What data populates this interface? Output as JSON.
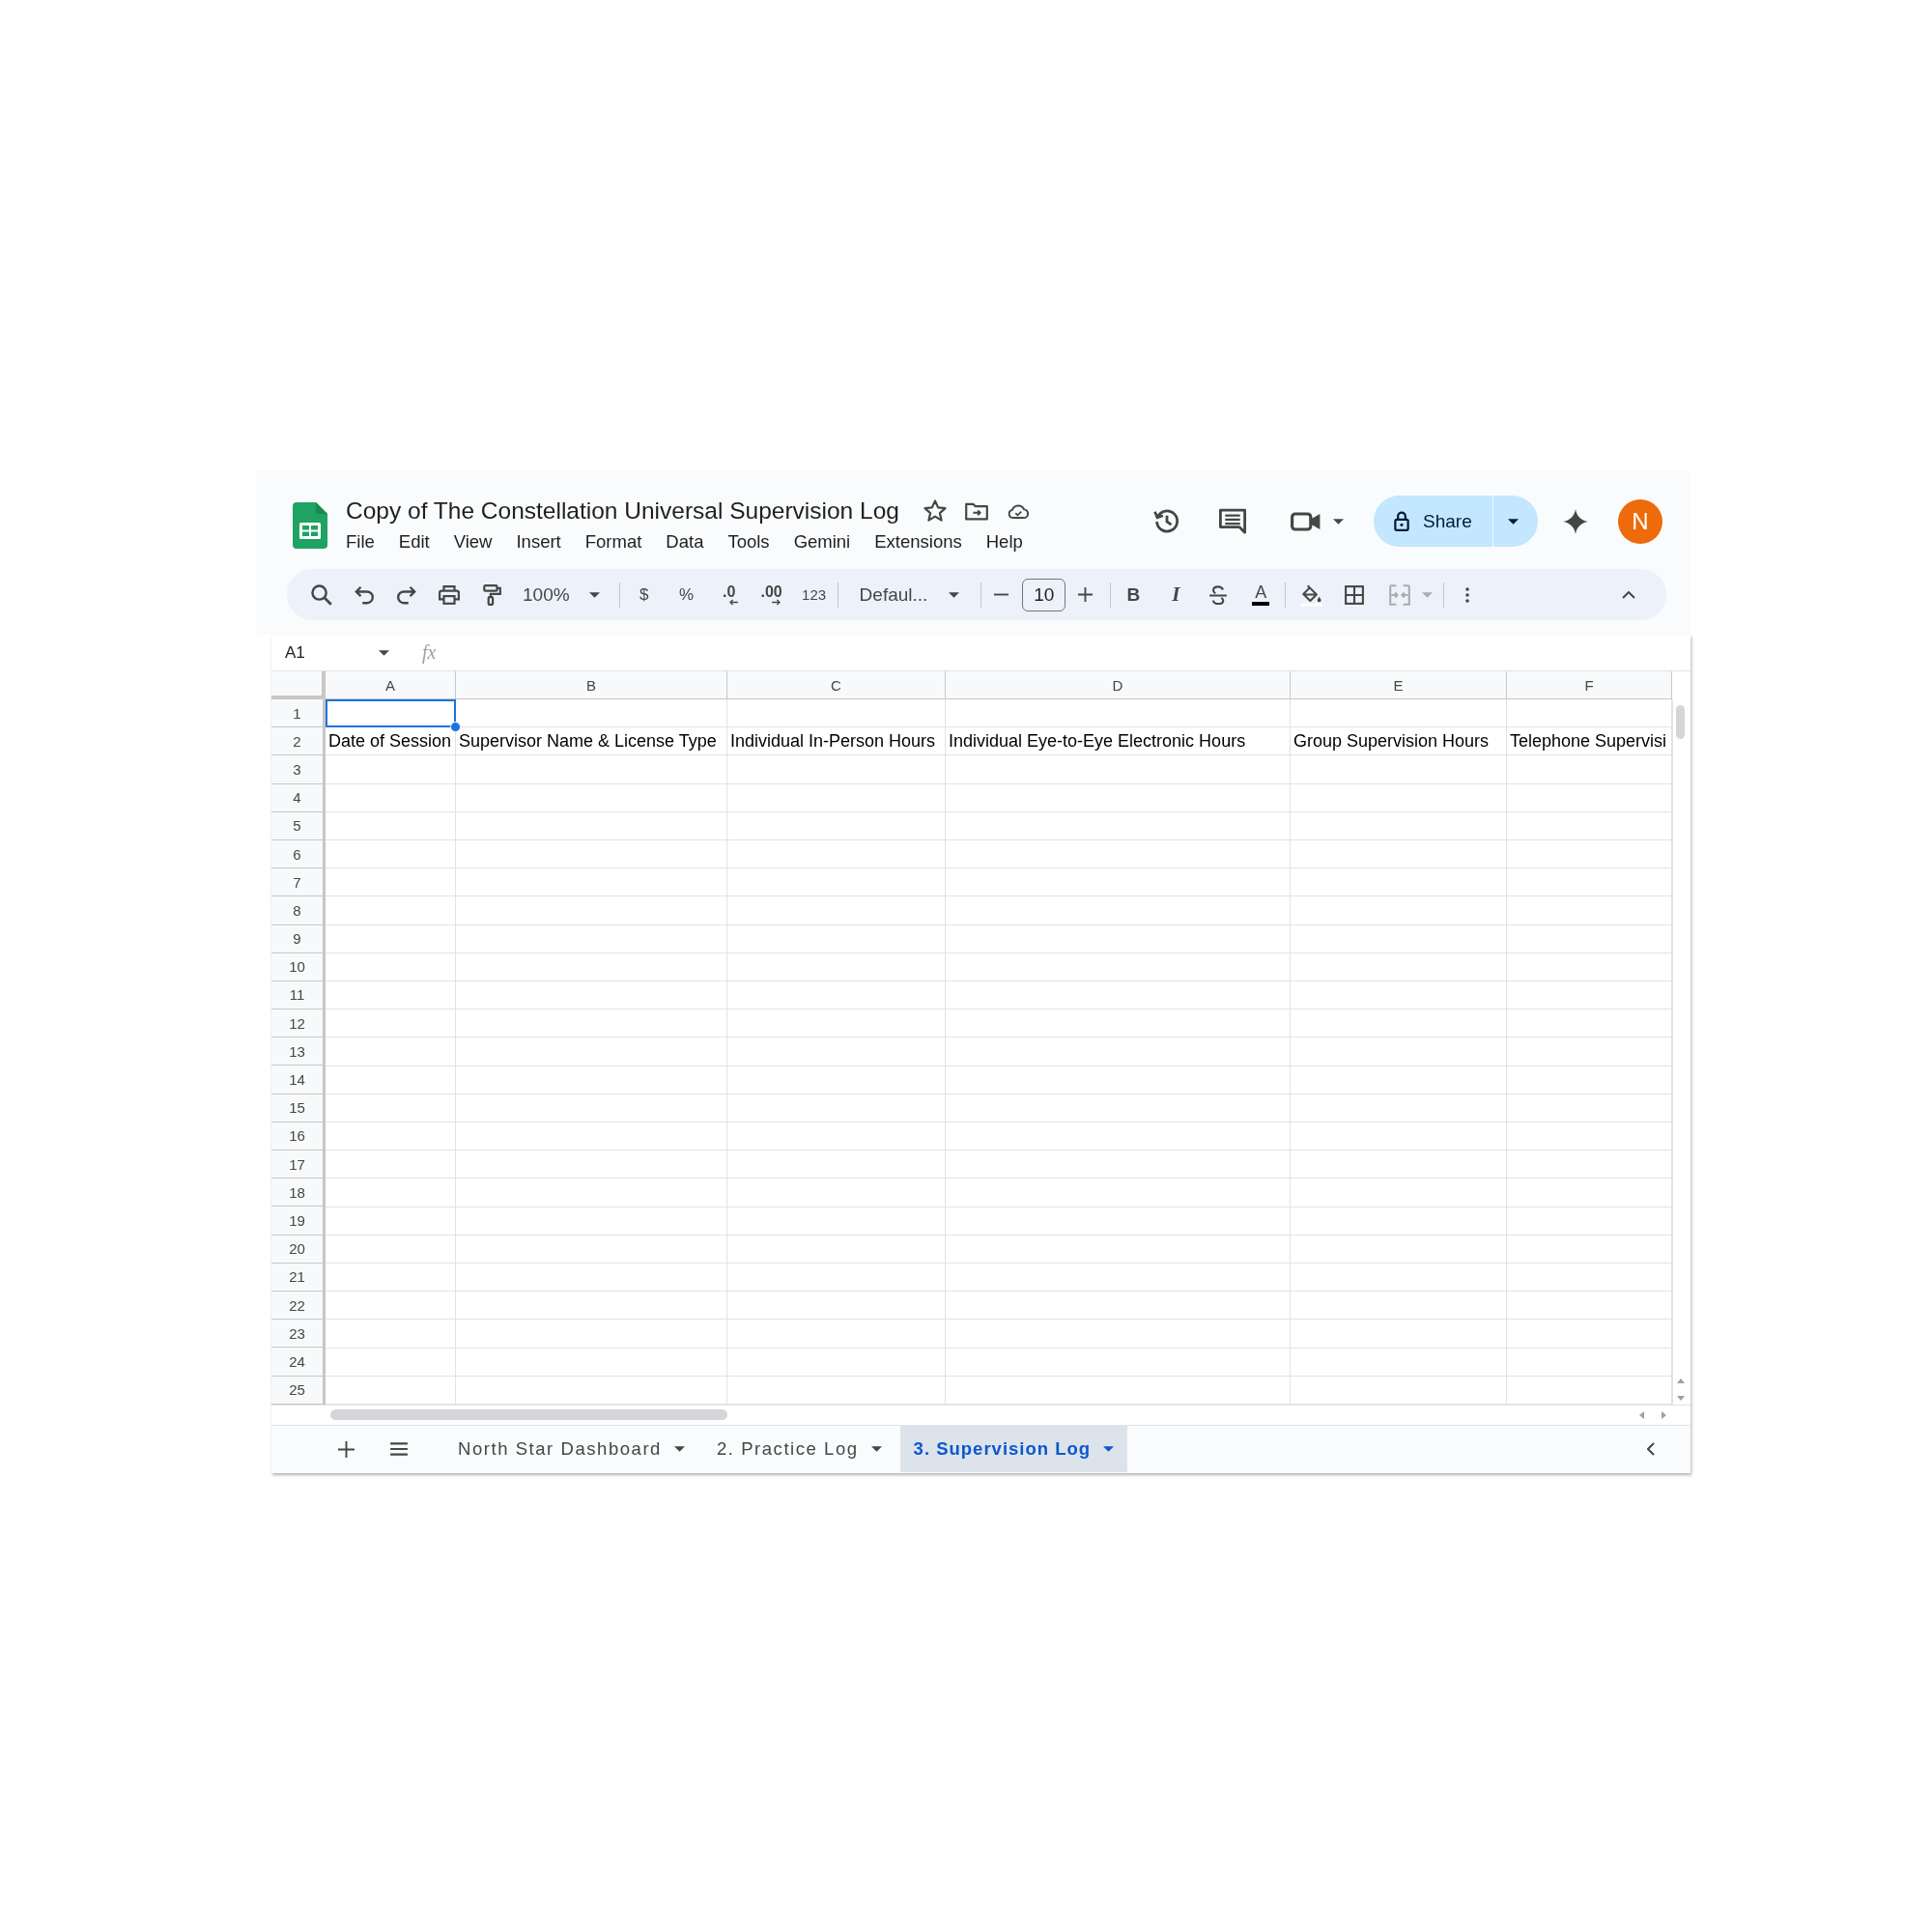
{
  "document": {
    "title": "Copy of The Constellation Universal Supervision Log"
  },
  "menu": [
    "File",
    "Edit",
    "View",
    "Insert",
    "Format",
    "Data",
    "Tools",
    "Gemini",
    "Extensions",
    "Help"
  ],
  "account": {
    "share_label": "Share",
    "avatar_initial": "N"
  },
  "toolbar": {
    "zoom": "100%",
    "currency": "$",
    "percent": "%",
    "decrease_decimals": ".0",
    "increase_decimals": ".00",
    "number_format": "123",
    "font": "Defaul...",
    "font_size": "10",
    "bold": "B",
    "italic": "I",
    "text_color": "A"
  },
  "formula_bar": {
    "name_box": "A1",
    "function_label": "fx"
  },
  "grid": {
    "columns": [
      "A",
      "B",
      "C",
      "D",
      "E",
      "F"
    ],
    "rows": [
      {
        "number": "1",
        "cells": [
          {
            "selected": true
          },
          {
            "selected": false
          },
          {
            "selected": false
          },
          {
            "selected": false
          },
          {
            "selected": false
          },
          {
            "selected": false
          }
        ]
      },
      {
        "number": "2",
        "cells": [
          {
            "text": "Date of Session",
            "selected": false
          },
          {
            "text": "Supervisor Name & License Type",
            "selected": false
          },
          {
            "text": "Individual In-Person Hours",
            "selected": false
          },
          {
            "text": "Individual Eye-to-Eye Electronic Hours",
            "selected": false
          },
          {
            "text": "Group Supervision Hours",
            "selected": false
          },
          {
            "text": "Telephone Supervisi",
            "selected": false
          }
        ]
      },
      {
        "number": "3",
        "cells": [
          {
            "selected": false
          },
          {
            "selected": false
          },
          {
            "selected": false
          },
          {
            "selected": false
          },
          {
            "selected": false
          },
          {
            "selected": false
          }
        ]
      },
      {
        "number": "4",
        "cells": [
          {
            "selected": false
          },
          {
            "selected": false
          },
          {
            "selected": false
          },
          {
            "selected": false
          },
          {
            "selected": false
          },
          {
            "selected": false
          }
        ]
      },
      {
        "number": "5",
        "cells": [
          {
            "selected": false
          },
          {
            "selected": false
          },
          {
            "selected": false
          },
          {
            "selected": false
          },
          {
            "selected": false
          },
          {
            "selected": false
          }
        ]
      },
      {
        "number": "6",
        "cells": [
          {
            "selected": false
          },
          {
            "selected": false
          },
          {
            "selected": false
          },
          {
            "selected": false
          },
          {
            "selected": false
          },
          {
            "selected": false
          }
        ]
      },
      {
        "number": "7",
        "cells": [
          {
            "selected": false
          },
          {
            "selected": false
          },
          {
            "selected": false
          },
          {
            "selected": false
          },
          {
            "selected": false
          },
          {
            "selected": false
          }
        ]
      },
      {
        "number": "8",
        "cells": [
          {
            "selected": false
          },
          {
            "selected": false
          },
          {
            "selected": false
          },
          {
            "selected": false
          },
          {
            "selected": false
          },
          {
            "selected": false
          }
        ]
      },
      {
        "number": "9",
        "cells": [
          {
            "selected": false
          },
          {
            "selected": false
          },
          {
            "selected": false
          },
          {
            "selected": false
          },
          {
            "selected": false
          },
          {
            "selected": false
          }
        ]
      },
      {
        "number": "10",
        "cells": [
          {
            "selected": false
          },
          {
            "selected": false
          },
          {
            "selected": false
          },
          {
            "selected": false
          },
          {
            "selected": false
          },
          {
            "selected": false
          }
        ]
      },
      {
        "number": "11",
        "cells": [
          {
            "selected": false
          },
          {
            "selected": false
          },
          {
            "selected": false
          },
          {
            "selected": false
          },
          {
            "selected": false
          },
          {
            "selected": false
          }
        ]
      },
      {
        "number": "12",
        "cells": [
          {
            "selected": false
          },
          {
            "selected": false
          },
          {
            "selected": false
          },
          {
            "selected": false
          },
          {
            "selected": false
          },
          {
            "selected": false
          }
        ]
      },
      {
        "number": "13",
        "cells": [
          {
            "selected": false
          },
          {
            "selected": false
          },
          {
            "selected": false
          },
          {
            "selected": false
          },
          {
            "selected": false
          },
          {
            "selected": false
          }
        ]
      },
      {
        "number": "14",
        "cells": [
          {
            "selected": false
          },
          {
            "selected": false
          },
          {
            "selected": false
          },
          {
            "selected": false
          },
          {
            "selected": false
          },
          {
            "selected": false
          }
        ]
      },
      {
        "number": "15",
        "cells": [
          {
            "selected": false
          },
          {
            "selected": false
          },
          {
            "selected": false
          },
          {
            "selected": false
          },
          {
            "selected": false
          },
          {
            "selected": false
          }
        ]
      },
      {
        "number": "16",
        "cells": [
          {
            "selected": false
          },
          {
            "selected": false
          },
          {
            "selected": false
          },
          {
            "selected": false
          },
          {
            "selected": false
          },
          {
            "selected": false
          }
        ]
      },
      {
        "number": "17",
        "cells": [
          {
            "selected": false
          },
          {
            "selected": false
          },
          {
            "selected": false
          },
          {
            "selected": false
          },
          {
            "selected": false
          },
          {
            "selected": false
          }
        ]
      },
      {
        "number": "18",
        "cells": [
          {
            "selected": false
          },
          {
            "selected": false
          },
          {
            "selected": false
          },
          {
            "selected": false
          },
          {
            "selected": false
          },
          {
            "selected": false
          }
        ]
      },
      {
        "number": "19",
        "cells": [
          {
            "selected": false
          },
          {
            "selected": false
          },
          {
            "selected": false
          },
          {
            "selected": false
          },
          {
            "selected": false
          },
          {
            "selected": false
          }
        ]
      },
      {
        "number": "20",
        "cells": [
          {
            "selected": false
          },
          {
            "selected": false
          },
          {
            "selected": false
          },
          {
            "selected": false
          },
          {
            "selected": false
          },
          {
            "selected": false
          }
        ]
      },
      {
        "number": "21",
        "cells": [
          {
            "selected": false
          },
          {
            "selected": false
          },
          {
            "selected": false
          },
          {
            "selected": false
          },
          {
            "selected": false
          },
          {
            "selected": false
          }
        ]
      },
      {
        "number": "22",
        "cells": [
          {
            "selected": false
          },
          {
            "selected": false
          },
          {
            "selected": false
          },
          {
            "selected": false
          },
          {
            "selected": false
          },
          {
            "selected": false
          }
        ]
      },
      {
        "number": "23",
        "cells": [
          {
            "selected": false
          },
          {
            "selected": false
          },
          {
            "selected": false
          },
          {
            "selected": false
          },
          {
            "selected": false
          },
          {
            "selected": false
          }
        ]
      },
      {
        "number": "24",
        "cells": [
          {
            "selected": false
          },
          {
            "selected": false
          },
          {
            "selected": false
          },
          {
            "selected": false
          },
          {
            "selected": false
          },
          {
            "selected": false
          }
        ]
      },
      {
        "number": "25",
        "cells": [
          {
            "selected": false
          },
          {
            "selected": false
          },
          {
            "selected": false
          },
          {
            "selected": false
          },
          {
            "selected": false
          },
          {
            "selected": false
          }
        ]
      }
    ]
  },
  "sheet_tabs": [
    {
      "label": "North Star Dashboard",
      "selected": false
    },
    {
      "label": "2. Practice Log",
      "selected": false
    },
    {
      "label": "3. Supervision Log",
      "selected": true
    }
  ]
}
